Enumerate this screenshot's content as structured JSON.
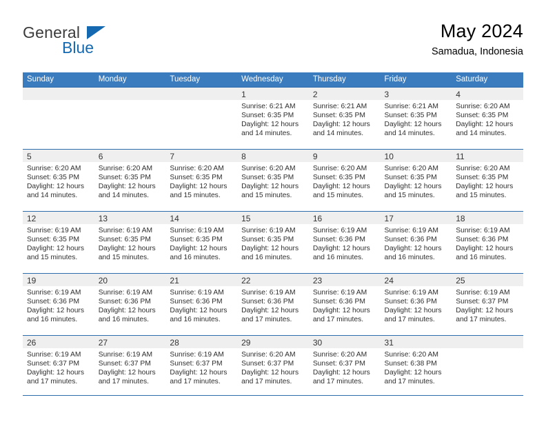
{
  "brand": {
    "line1": "General",
    "line2": "Blue",
    "triangle_color": "#1569b0"
  },
  "header": {
    "title": "May 2024",
    "subtitle": "Samadua, Indonesia"
  },
  "theme": {
    "header_row_bg": "#3b7cbf",
    "cell_border": "#2b6cad",
    "daynum_bar_bg": "#efefef",
    "brand_blue": "#1569b0"
  },
  "weekday_headers": [
    "Sunday",
    "Monday",
    "Tuesday",
    "Wednesday",
    "Thursday",
    "Friday",
    "Saturday"
  ],
  "weeks": [
    [
      {
        "day": "",
        "empty": true,
        "sunrise": "",
        "sunset": "",
        "daylight1": "",
        "daylight2": ""
      },
      {
        "day": "",
        "empty": true,
        "sunrise": "",
        "sunset": "",
        "daylight1": "",
        "daylight2": ""
      },
      {
        "day": "",
        "empty": true,
        "sunrise": "",
        "sunset": "",
        "daylight1": "",
        "daylight2": ""
      },
      {
        "day": "1",
        "empty": false,
        "sunrise": "Sunrise: 6:21 AM",
        "sunset": "Sunset: 6:35 PM",
        "daylight1": "Daylight: 12 hours",
        "daylight2": "and 14 minutes."
      },
      {
        "day": "2",
        "empty": false,
        "sunrise": "Sunrise: 6:21 AM",
        "sunset": "Sunset: 6:35 PM",
        "daylight1": "Daylight: 12 hours",
        "daylight2": "and 14 minutes."
      },
      {
        "day": "3",
        "empty": false,
        "sunrise": "Sunrise: 6:21 AM",
        "sunset": "Sunset: 6:35 PM",
        "daylight1": "Daylight: 12 hours",
        "daylight2": "and 14 minutes."
      },
      {
        "day": "4",
        "empty": false,
        "sunrise": "Sunrise: 6:20 AM",
        "sunset": "Sunset: 6:35 PM",
        "daylight1": "Daylight: 12 hours",
        "daylight2": "and 14 minutes."
      }
    ],
    [
      {
        "day": "5",
        "empty": false,
        "sunrise": "Sunrise: 6:20 AM",
        "sunset": "Sunset: 6:35 PM",
        "daylight1": "Daylight: 12 hours",
        "daylight2": "and 14 minutes."
      },
      {
        "day": "6",
        "empty": false,
        "sunrise": "Sunrise: 6:20 AM",
        "sunset": "Sunset: 6:35 PM",
        "daylight1": "Daylight: 12 hours",
        "daylight2": "and 14 minutes."
      },
      {
        "day": "7",
        "empty": false,
        "sunrise": "Sunrise: 6:20 AM",
        "sunset": "Sunset: 6:35 PM",
        "daylight1": "Daylight: 12 hours",
        "daylight2": "and 15 minutes."
      },
      {
        "day": "8",
        "empty": false,
        "sunrise": "Sunrise: 6:20 AM",
        "sunset": "Sunset: 6:35 PM",
        "daylight1": "Daylight: 12 hours",
        "daylight2": "and 15 minutes."
      },
      {
        "day": "9",
        "empty": false,
        "sunrise": "Sunrise: 6:20 AM",
        "sunset": "Sunset: 6:35 PM",
        "daylight1": "Daylight: 12 hours",
        "daylight2": "and 15 minutes."
      },
      {
        "day": "10",
        "empty": false,
        "sunrise": "Sunrise: 6:20 AM",
        "sunset": "Sunset: 6:35 PM",
        "daylight1": "Daylight: 12 hours",
        "daylight2": "and 15 minutes."
      },
      {
        "day": "11",
        "empty": false,
        "sunrise": "Sunrise: 6:20 AM",
        "sunset": "Sunset: 6:35 PM",
        "daylight1": "Daylight: 12 hours",
        "daylight2": "and 15 minutes."
      }
    ],
    [
      {
        "day": "12",
        "empty": false,
        "sunrise": "Sunrise: 6:19 AM",
        "sunset": "Sunset: 6:35 PM",
        "daylight1": "Daylight: 12 hours",
        "daylight2": "and 15 minutes."
      },
      {
        "day": "13",
        "empty": false,
        "sunrise": "Sunrise: 6:19 AM",
        "sunset": "Sunset: 6:35 PM",
        "daylight1": "Daylight: 12 hours",
        "daylight2": "and 15 minutes."
      },
      {
        "day": "14",
        "empty": false,
        "sunrise": "Sunrise: 6:19 AM",
        "sunset": "Sunset: 6:35 PM",
        "daylight1": "Daylight: 12 hours",
        "daylight2": "and 16 minutes."
      },
      {
        "day": "15",
        "empty": false,
        "sunrise": "Sunrise: 6:19 AM",
        "sunset": "Sunset: 6:35 PM",
        "daylight1": "Daylight: 12 hours",
        "daylight2": "and 16 minutes."
      },
      {
        "day": "16",
        "empty": false,
        "sunrise": "Sunrise: 6:19 AM",
        "sunset": "Sunset: 6:36 PM",
        "daylight1": "Daylight: 12 hours",
        "daylight2": "and 16 minutes."
      },
      {
        "day": "17",
        "empty": false,
        "sunrise": "Sunrise: 6:19 AM",
        "sunset": "Sunset: 6:36 PM",
        "daylight1": "Daylight: 12 hours",
        "daylight2": "and 16 minutes."
      },
      {
        "day": "18",
        "empty": false,
        "sunrise": "Sunrise: 6:19 AM",
        "sunset": "Sunset: 6:36 PM",
        "daylight1": "Daylight: 12 hours",
        "daylight2": "and 16 minutes."
      }
    ],
    [
      {
        "day": "19",
        "empty": false,
        "sunrise": "Sunrise: 6:19 AM",
        "sunset": "Sunset: 6:36 PM",
        "daylight1": "Daylight: 12 hours",
        "daylight2": "and 16 minutes."
      },
      {
        "day": "20",
        "empty": false,
        "sunrise": "Sunrise: 6:19 AM",
        "sunset": "Sunset: 6:36 PM",
        "daylight1": "Daylight: 12 hours",
        "daylight2": "and 16 minutes."
      },
      {
        "day": "21",
        "empty": false,
        "sunrise": "Sunrise: 6:19 AM",
        "sunset": "Sunset: 6:36 PM",
        "daylight1": "Daylight: 12 hours",
        "daylight2": "and 16 minutes."
      },
      {
        "day": "22",
        "empty": false,
        "sunrise": "Sunrise: 6:19 AM",
        "sunset": "Sunset: 6:36 PM",
        "daylight1": "Daylight: 12 hours",
        "daylight2": "and 17 minutes."
      },
      {
        "day": "23",
        "empty": false,
        "sunrise": "Sunrise: 6:19 AM",
        "sunset": "Sunset: 6:36 PM",
        "daylight1": "Daylight: 12 hours",
        "daylight2": "and 17 minutes."
      },
      {
        "day": "24",
        "empty": false,
        "sunrise": "Sunrise: 6:19 AM",
        "sunset": "Sunset: 6:36 PM",
        "daylight1": "Daylight: 12 hours",
        "daylight2": "and 17 minutes."
      },
      {
        "day": "25",
        "empty": false,
        "sunrise": "Sunrise: 6:19 AM",
        "sunset": "Sunset: 6:37 PM",
        "daylight1": "Daylight: 12 hours",
        "daylight2": "and 17 minutes."
      }
    ],
    [
      {
        "day": "26",
        "empty": false,
        "sunrise": "Sunrise: 6:19 AM",
        "sunset": "Sunset: 6:37 PM",
        "daylight1": "Daylight: 12 hours",
        "daylight2": "and 17 minutes."
      },
      {
        "day": "27",
        "empty": false,
        "sunrise": "Sunrise: 6:19 AM",
        "sunset": "Sunset: 6:37 PM",
        "daylight1": "Daylight: 12 hours",
        "daylight2": "and 17 minutes."
      },
      {
        "day": "28",
        "empty": false,
        "sunrise": "Sunrise: 6:19 AM",
        "sunset": "Sunset: 6:37 PM",
        "daylight1": "Daylight: 12 hours",
        "daylight2": "and 17 minutes."
      },
      {
        "day": "29",
        "empty": false,
        "sunrise": "Sunrise: 6:20 AM",
        "sunset": "Sunset: 6:37 PM",
        "daylight1": "Daylight: 12 hours",
        "daylight2": "and 17 minutes."
      },
      {
        "day": "30",
        "empty": false,
        "sunrise": "Sunrise: 6:20 AM",
        "sunset": "Sunset: 6:37 PM",
        "daylight1": "Daylight: 12 hours",
        "daylight2": "and 17 minutes."
      },
      {
        "day": "31",
        "empty": false,
        "sunrise": "Sunrise: 6:20 AM",
        "sunset": "Sunset: 6:38 PM",
        "daylight1": "Daylight: 12 hours",
        "daylight2": "and 17 minutes."
      },
      {
        "day": "",
        "empty": true,
        "sunrise": "",
        "sunset": "",
        "daylight1": "",
        "daylight2": ""
      }
    ]
  ]
}
